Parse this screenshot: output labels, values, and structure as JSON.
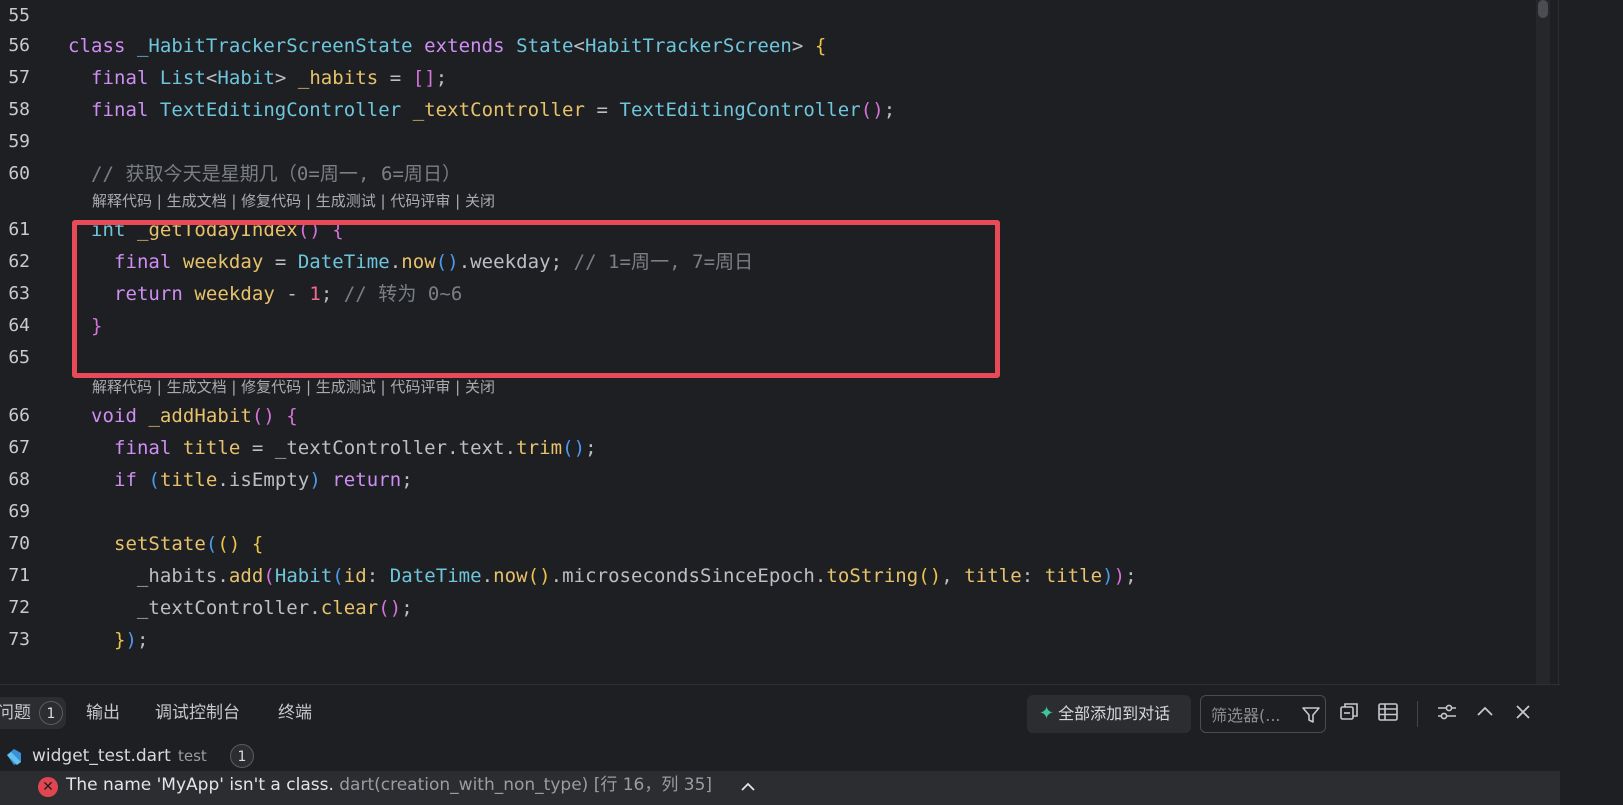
{
  "editor": {
    "lines": [
      {
        "n": "55",
        "tokens": []
      },
      {
        "n": "56",
        "tokens": [
          [
            "kw",
            "class "
          ],
          [
            "ty",
            "_HabitTrackerScreenState "
          ],
          [
            "kw",
            "extends "
          ],
          [
            "ty",
            "State"
          ],
          [
            "",
            "<"
          ],
          [
            "ty",
            "HabitTrackerScreen"
          ],
          [
            "",
            "> "
          ],
          [
            "p1",
            "{"
          ]
        ]
      },
      {
        "n": "57",
        "tokens": [
          [
            "",
            "  "
          ],
          [
            "kw",
            "final "
          ],
          [
            "ty",
            "List"
          ],
          [
            "",
            "<"
          ],
          [
            "ty",
            "Habit"
          ],
          [
            "",
            "> "
          ],
          [
            "fn",
            "_habits"
          ],
          [
            "",
            " = "
          ],
          [
            "p2",
            "[]"
          ],
          [
            "",
            ";"
          ]
        ]
      },
      {
        "n": "58",
        "tokens": [
          [
            "",
            "  "
          ],
          [
            "kw",
            "final "
          ],
          [
            "ty",
            "TextEditingController "
          ],
          [
            "fn",
            "_textController"
          ],
          [
            "",
            " = "
          ],
          [
            "ty",
            "TextEditingController"
          ],
          [
            "p2",
            "()"
          ],
          [
            "",
            ";"
          ]
        ]
      },
      {
        "n": "59",
        "tokens": []
      },
      {
        "n": "60",
        "tokens": [
          [
            "",
            "  "
          ],
          [
            "cm",
            "// 获取今天是星期几（0=周一, 6=周日）"
          ]
        ]
      },
      {
        "n": "61",
        "tokens": [
          [
            "",
            "  "
          ],
          [
            "ty",
            "int "
          ],
          [
            "fn",
            "_getTodayIndex"
          ],
          [
            "p2",
            "() {"
          ]
        ]
      },
      {
        "n": "62",
        "tokens": [
          [
            "",
            "    "
          ],
          [
            "kw",
            "final "
          ],
          [
            "fn",
            "weekday"
          ],
          [
            "",
            " = "
          ],
          [
            "ty",
            "DateTime"
          ],
          [
            "",
            "."
          ],
          [
            "fn",
            "now"
          ],
          [
            "p3",
            "()"
          ],
          [
            "",
            ".weekday; "
          ],
          [
            "cm",
            "// 1=周一, 7=周日"
          ]
        ]
      },
      {
        "n": "63",
        "tokens": [
          [
            "",
            "    "
          ],
          [
            "kw",
            "return "
          ],
          [
            "fn",
            "weekday"
          ],
          [
            "",
            " - "
          ],
          [
            "nu",
            "1"
          ],
          [
            "",
            "; "
          ],
          [
            "cm",
            "// 转为 0~6"
          ]
        ]
      },
      {
        "n": "64",
        "tokens": [
          [
            "",
            "  "
          ],
          [
            "p2",
            "}"
          ]
        ]
      },
      {
        "n": "65",
        "tokens": []
      },
      {
        "n": "66",
        "tokens": [
          [
            "",
            "  "
          ],
          [
            "kw",
            "void "
          ],
          [
            "fn",
            "_addHabit"
          ],
          [
            "p2",
            "() {"
          ]
        ]
      },
      {
        "n": "67",
        "tokens": [
          [
            "",
            "    "
          ],
          [
            "kw",
            "final "
          ],
          [
            "fn",
            "title"
          ],
          [
            "",
            " = _textController.text."
          ],
          [
            "fn",
            "trim"
          ],
          [
            "p3",
            "()"
          ],
          [
            "",
            ";"
          ]
        ]
      },
      {
        "n": "68",
        "tokens": [
          [
            "",
            "    "
          ],
          [
            "kw",
            "if "
          ],
          [
            "p3",
            "("
          ],
          [
            "fn",
            "title"
          ],
          [
            "",
            ".isEmpty"
          ],
          [
            "p3",
            ")"
          ],
          [
            "kw",
            " return"
          ],
          [
            "",
            ";"
          ]
        ]
      },
      {
        "n": "69",
        "tokens": []
      },
      {
        "n": "70",
        "tokens": [
          [
            "",
            "    "
          ],
          [
            "fn",
            "setState"
          ],
          [
            "p3",
            "("
          ],
          [
            "p1",
            "() {"
          ]
        ]
      },
      {
        "n": "71",
        "tokens": [
          [
            "",
            "      _habits."
          ],
          [
            "fn",
            "add"
          ],
          [
            "p2",
            "("
          ],
          [
            "ty",
            "Habit"
          ],
          [
            "p3",
            "("
          ],
          [
            "fn",
            "id"
          ],
          [
            "",
            ": "
          ],
          [
            "ty",
            "DateTime"
          ],
          [
            "",
            "."
          ],
          [
            "fn",
            "now"
          ],
          [
            "p1",
            "()"
          ],
          [
            "",
            ".microsecondsSinceEpoch."
          ],
          [
            "fn",
            "toString"
          ],
          [
            "p1",
            "()"
          ],
          [
            "",
            ", "
          ],
          [
            "fn",
            "title"
          ],
          [
            "",
            ": "
          ],
          [
            "fn",
            "title"
          ],
          [
            "p3",
            ")"
          ],
          [
            "p2",
            ")"
          ],
          [
            "",
            ";"
          ]
        ]
      },
      {
        "n": "72",
        "tokens": [
          [
            "",
            "      _textController."
          ],
          [
            "fn",
            "clear"
          ],
          [
            "p2",
            "()"
          ],
          [
            "",
            ";"
          ]
        ]
      },
      {
        "n": "73",
        "tokens": [
          [
            "",
            "    "
          ],
          [
            "p1",
            "}"
          ],
          [
            "p3",
            ")"
          ],
          [
            "",
            ";"
          ]
        ]
      }
    ],
    "codelens": "解释代码 | 生成文档 | 修复代码 | 生成测试 | 代码评审 | 关闭"
  },
  "panel": {
    "tabs": [
      {
        "label": "问题",
        "badge": "1"
      },
      {
        "label": "输出"
      },
      {
        "label": "调试控制台"
      },
      {
        "label": "终端"
      }
    ],
    "add_all_label": "全部添加到对话",
    "filter_placeholder": "筛选器(...",
    "file": {
      "name": "widget_test.dart",
      "dir": "test",
      "count": "1"
    },
    "error": {
      "message": "The name 'MyApp' isn't a class.",
      "source": " dart(creation_with_non_type)",
      "location": " [行 16，列 35]"
    }
  },
  "colors": {
    "accent": "#3fc49b",
    "error": "#e0464f",
    "highlight": "#e84a57"
  }
}
